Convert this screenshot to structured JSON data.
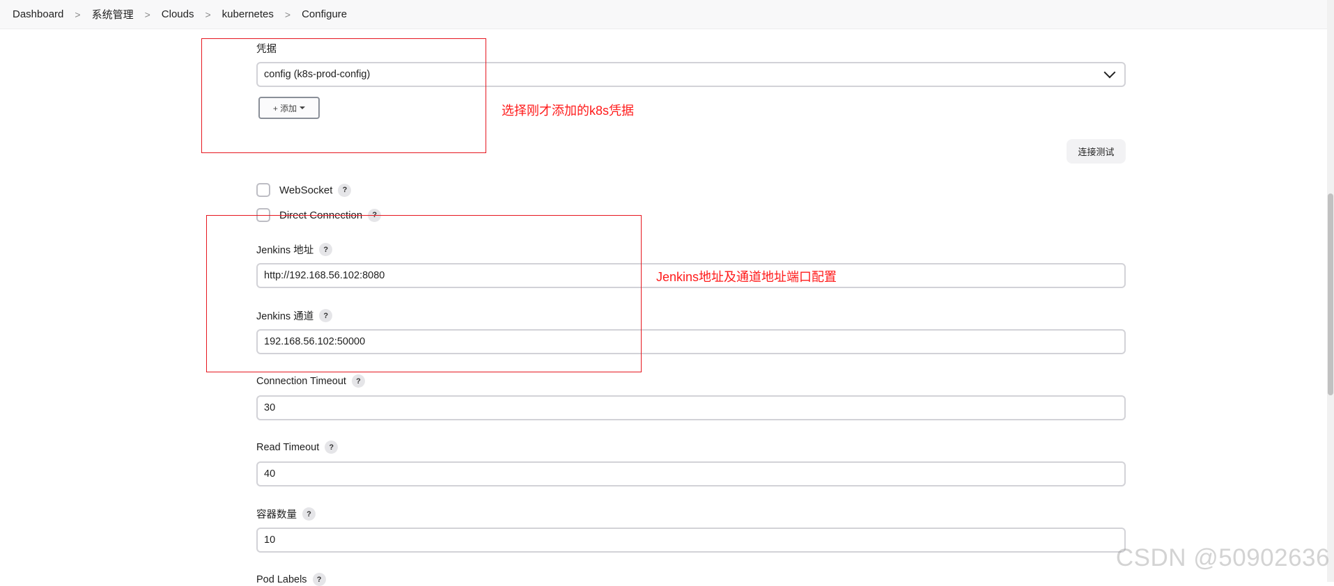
{
  "breadcrumb": {
    "items": [
      "Dashboard",
      "系统管理",
      "Clouds",
      "kubernetes",
      "Configure"
    ],
    "separator": ">"
  },
  "credentials": {
    "label": "凭据",
    "selected": "config (k8s-prod-config)",
    "add_button": "+ 添加"
  },
  "test_connection_button": "连接测试",
  "websocket": {
    "label": "WebSocket",
    "checked": false
  },
  "direct_connection": {
    "label": "Direct Connection",
    "checked": false
  },
  "jenkins_url": {
    "label": "Jenkins 地址",
    "value": "http://192.168.56.102:8080"
  },
  "jenkins_tunnel": {
    "label": "Jenkins 通道",
    "value": "192.168.56.102:50000"
  },
  "connection_timeout": {
    "label": "Connection Timeout",
    "value": "30"
  },
  "read_timeout": {
    "label": "Read Timeout",
    "value": "40"
  },
  "container_cap": {
    "label": "容器数量",
    "value": "10"
  },
  "pod_labels": {
    "label": "Pod Labels"
  },
  "help_glyph": "?",
  "annotations": {
    "credentials_note": "选择刚才添加的k8s凭据",
    "jenkins_note": "Jenkins地址及通道地址端口配置",
    "color": "#ff1a1a"
  },
  "watermark": "CSDN @50902636"
}
